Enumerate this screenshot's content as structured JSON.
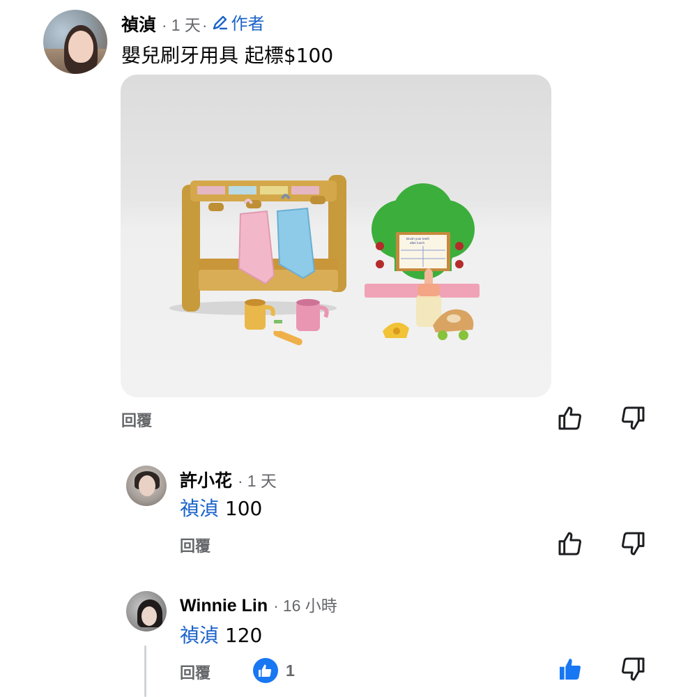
{
  "main_comment": {
    "author": "禎湞",
    "time": "1 天",
    "author_badge": "作者",
    "text": "嬰兒刷牙用具 起標$100",
    "reply_label": "回覆"
  },
  "replies": [
    {
      "author": "許小花",
      "time": "1 天",
      "mention": "禎湞",
      "text": "100",
      "reply_label": "回覆"
    },
    {
      "author": "Winnie Lin",
      "time": "16 小時",
      "mention": "禎湞",
      "text": "120",
      "reply_label": "回覆",
      "reaction_count": "1"
    }
  ],
  "photo_sign_text": [
    "Brush your teeth",
    "after lunch"
  ],
  "colors": {
    "link_blue": "#1b63c9",
    "meta_gray": "#65676b",
    "like_active": "#1877f2"
  },
  "icons": [
    "pencil-icon",
    "thumbs-up-icon",
    "thumbs-down-icon",
    "like-reaction-icon"
  ]
}
